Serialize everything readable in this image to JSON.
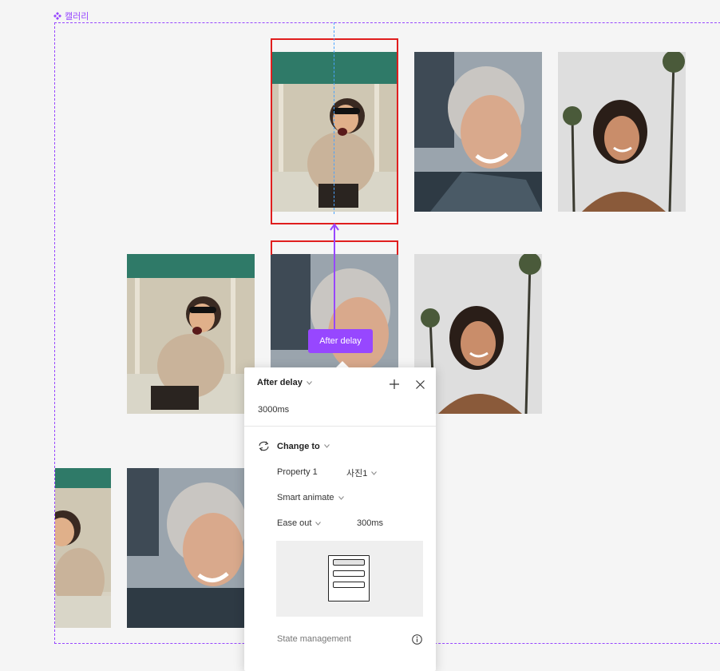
{
  "component": {
    "label": "캘러리",
    "color": "#9747ff"
  },
  "trigger": {
    "pill_label": "After delay"
  },
  "panel": {
    "trigger_label": "After delay",
    "delay_value": "3000ms",
    "action_label": "Change to",
    "property_label": "Property 1",
    "property_value": "사진1",
    "animation_label": "Smart animate",
    "easing_label": "Ease out",
    "duration_value": "300ms",
    "state_management_label": "State management"
  },
  "icons": [
    "component-icon",
    "add-icon",
    "close-icon",
    "swap-icon",
    "chevron-down-icon",
    "info-icon"
  ]
}
